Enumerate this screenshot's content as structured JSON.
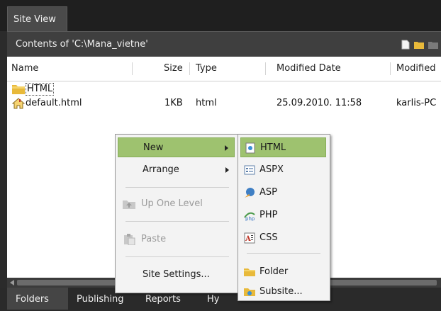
{
  "tabs": {
    "site_view": "Site View"
  },
  "path": {
    "label": "Contents of 'C:\\Mana_vietne'"
  },
  "columns": [
    "Name",
    "Size",
    "Type",
    "Modified Date",
    "Modified"
  ],
  "files": [
    {
      "name": "HTML",
      "size": "",
      "type": "",
      "date": "",
      "modified_by": ""
    },
    {
      "name": "default.html",
      "size": "1KB",
      "type": "html",
      "date": "25.09.2010. 11:58",
      "modified_by": "karlis-PC"
    }
  ],
  "context_menu": {
    "new": "New",
    "arrange": "Arrange",
    "up_one_level": "Up One Level",
    "paste": "Paste",
    "site_settings": "Site Settings..."
  },
  "submenu": {
    "html": "HTML",
    "aspx": "ASPX",
    "asp": "ASP",
    "php": "PHP",
    "css": "CSS",
    "folder": "Folder",
    "subsite": "Subsite..."
  },
  "bottom_tabs": [
    "Folders",
    "Publishing",
    "Reports",
    "Hy"
  ],
  "colors": {
    "menu_highlight": "#9ec26f",
    "folder_yellow": "#e8b93a"
  }
}
